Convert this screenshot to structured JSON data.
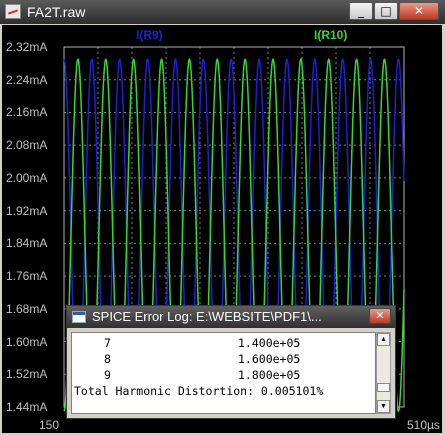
{
  "window": {
    "title": "FA2T.raw",
    "minimize": "_",
    "maximize": "□",
    "close": "✕",
    "icon": "ltspice-waveform-icon"
  },
  "plot": {
    "background": "#000000",
    "grid_color": "#7a7a7a",
    "y_ticks": [
      "2.32mA",
      "2.24mA",
      "2.16mA",
      "2.08mA",
      "2.00mA",
      "1.92mA",
      "1.84mA",
      "1.76mA",
      "1.68mA",
      "1.60mA",
      "1.52mA",
      "1.44mA"
    ],
    "x_start": "150",
    "x_end": "510µs"
  },
  "chart_data": {
    "type": "line",
    "x_range": [
      150,
      510
    ],
    "x_unit": "µs",
    "ylim": [
      1.44,
      2.32
    ],
    "y_unit": "mA",
    "grid": true,
    "series": [
      {
        "name": "I(R9)",
        "color": "#1f1fd8",
        "amplitude_mA": 0.43,
        "offset_mA": 1.86,
        "cycles": 12.2,
        "phase_deg": 90
      },
      {
        "name": "I(R10)",
        "color": "#2edc2e",
        "amplitude_mA": 0.43,
        "offset_mA": 1.86,
        "cycles": 12.2,
        "phase_deg": -90
      }
    ]
  },
  "error_log": {
    "title": "SPICE Error Log: E:\\WEBSITE\\PDF1\\...",
    "close": "✕",
    "rows": [
      {
        "harmonic": "7",
        "freq": "1.400e+05"
      },
      {
        "harmonic": "8",
        "freq": "1.600e+05"
      },
      {
        "harmonic": "9",
        "freq": "1.800e+05"
      }
    ],
    "thd": "Total Harmonic Distortion: 0.005101%"
  }
}
